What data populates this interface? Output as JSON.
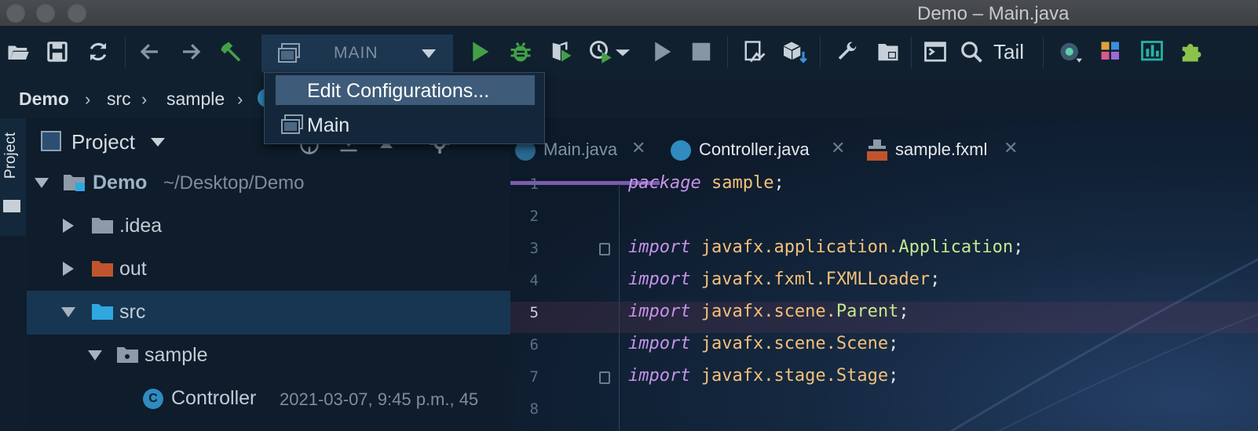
{
  "window": {
    "title": "Demo – Main.java"
  },
  "toolbar": {
    "run_config": "MAIN",
    "tail_label": "Tail",
    "icons": [
      "open-folder-icon",
      "save-icon",
      "sync-icon",
      "back-icon",
      "forward-icon",
      "build-hammer-icon",
      "run-config-icon",
      "chevron-down-icon",
      "run-icon",
      "debug-icon",
      "coverage-icon",
      "profile-icon",
      "profile-dropdown-icon",
      "play-icon",
      "stop-icon",
      "device-icon",
      "deploy-icon",
      "settings-wrench-icon",
      "project-structure-icon",
      "terminal-icon",
      "search-icon",
      "plugin-icons"
    ]
  },
  "popup": {
    "items": [
      {
        "label": "Edit Configurations...",
        "highlighted": true
      },
      {
        "label": "Main",
        "highlighted": false
      }
    ]
  },
  "breadcrumb": [
    "Demo",
    "src",
    "sample"
  ],
  "left_strip": {
    "label": "Project"
  },
  "project": {
    "title": "Project",
    "tree": [
      {
        "name": "Demo",
        "hint": "~/Desktop/Demo",
        "expanded": true,
        "bold": true
      },
      {
        "name": ".idea",
        "expanded": false
      },
      {
        "name": "out",
        "expanded": false
      },
      {
        "name": "src",
        "expanded": true,
        "selected": true
      },
      {
        "name": "sample",
        "expanded": true
      },
      {
        "name": "Controller",
        "hint": "2021-03-07, 9:45 p.m., 45"
      }
    ]
  },
  "editor": {
    "tabs": [
      {
        "label": "Main.java",
        "active": true
      },
      {
        "label": "Controller.java",
        "active": false
      },
      {
        "label": "sample.fxml",
        "active": false
      }
    ],
    "current_line": 5,
    "lines": [
      {
        "num": "1",
        "kw": "package",
        "pkg": " sample",
        "cls": "",
        "end": ";"
      },
      {
        "num": "2",
        "kw": "",
        "pkg": "",
        "cls": "",
        "end": ""
      },
      {
        "num": "3",
        "kw": "import",
        "pkg": " javafx.application.",
        "cls": "Application",
        "end": ";"
      },
      {
        "num": "4",
        "kw": "import",
        "pkg": " javafx.fxml.FXMLLoader",
        "cls": "",
        "end": ";"
      },
      {
        "num": "5",
        "kw": "import",
        "pkg": " javafx.scene.",
        "cls": "Parent",
        "end": ";"
      },
      {
        "num": "6",
        "kw": "import",
        "pkg": " javafx.scene.Scene",
        "cls": "",
        "end": ";"
      },
      {
        "num": "7",
        "kw": "import",
        "pkg": " javafx.stage.Stage",
        "cls": "",
        "end": ";"
      },
      {
        "num": "8",
        "kw": "",
        "pkg": "",
        "cls": "",
        "end": ""
      }
    ]
  }
}
